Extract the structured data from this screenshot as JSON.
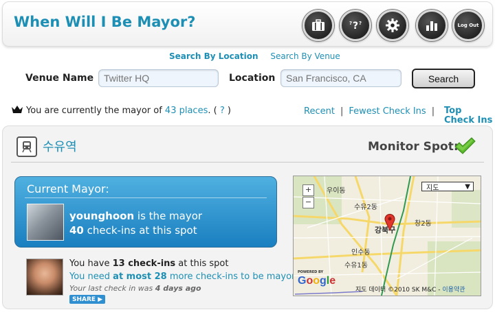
{
  "header": {
    "title": "When Will I Be Mayor?",
    "toolbar": [
      {
        "name": "briefcase-icon"
      },
      {
        "name": "help-icon",
        "label": "?"
      },
      {
        "name": "gear-icon"
      },
      {
        "name": "bar-chart-icon"
      },
      {
        "name": "logout",
        "label": "Log Out"
      }
    ]
  },
  "search": {
    "modes": [
      "Search By Location",
      "Search By Venue"
    ],
    "active_mode": "Search By Location",
    "venue_label": "Venue Name",
    "venue_placeholder": "Twitter HQ",
    "location_label": "Location",
    "location_placeholder": "San Francisco, CA",
    "button_label": "Search"
  },
  "status": {
    "prefix": "You are currently the mayor of",
    "count_link": "43 places",
    "suffix": ". (",
    "help": "?",
    "close": ")"
  },
  "sort": {
    "options": [
      "Recent",
      "Fewest Check Ins"
    ],
    "active": "Top Check Ins"
  },
  "venue": {
    "icon": "train-icon",
    "name": "수유역",
    "monitor_label": "Monitor Spot:",
    "current_mayor": {
      "title": "Current Mayor:",
      "username": "younghoon",
      "is_mayor_text": " is the mayor",
      "checkins": "40",
      "checkins_text": " check-ins at this spot"
    },
    "you": {
      "have_prefix": "You have ",
      "checkins": "13 check-ins",
      "have_suffix": " at this spot",
      "need_prefix": "You need ",
      "need_amount": "at most 28",
      "need_suffix": " more check-ins to be mayor!",
      "last_prefix": "Your last check in was ",
      "last_when": "4 days ago",
      "share_label": "SHARE ▶"
    }
  },
  "map": {
    "type_select": "지도",
    "zoom_in": "+",
    "zoom_out": "−",
    "labels": [
      "우이동",
      "수유2동",
      "창2동",
      "강북구",
      "인수동",
      "수유1동"
    ],
    "powered_by": "POWERED BY",
    "google": "Google",
    "copyright": "지도 데이터 ©2010 SK M&C - ",
    "terms": "이용약관"
  },
  "colors": {
    "accent": "#1e8fb4",
    "mayor_box": "#2a8fd0",
    "checkmark": "#5cb82c"
  }
}
